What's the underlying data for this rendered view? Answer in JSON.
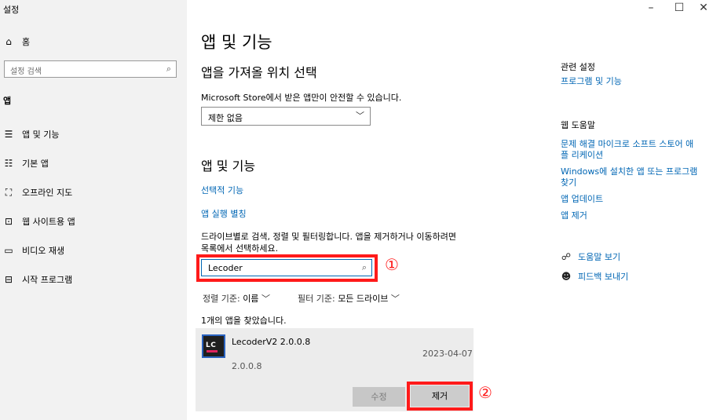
{
  "window": {
    "title": "설정",
    "controls": {
      "minimize": "–",
      "maximize": "☐",
      "close": "✕"
    }
  },
  "sidebar": {
    "home_label": "홈",
    "search_placeholder": "설정 검색",
    "section_title": "앱",
    "items": [
      {
        "label": "앱 및 기능",
        "icon": "list-icon",
        "glyph": "☰"
      },
      {
        "label": "기본 앱",
        "icon": "default-apps-icon",
        "glyph": "☷"
      },
      {
        "label": "오프라인 지도",
        "icon": "map-icon",
        "glyph": "⛶"
      },
      {
        "label": "웹 사이트용 앱",
        "icon": "website-app-icon",
        "glyph": "⊡"
      },
      {
        "label": "비디오 재생",
        "icon": "video-icon",
        "glyph": "▭"
      },
      {
        "label": "시작 프로그램",
        "icon": "startup-icon",
        "glyph": "⊟"
      }
    ]
  },
  "main": {
    "title": "앱 및 기능",
    "source_section": {
      "heading": "앱을 가져올 위치 선택",
      "description": "Microsoft Store에서 받은 앱만이 안전할 수 있습니다.",
      "dropdown_value": "제한 없음"
    },
    "apps_section": {
      "heading": "앱 및 기능",
      "optional_features_link": "선택적 기능",
      "app_aliases_link": "앱 실행 별칭",
      "instructions_line1": "드라이브별로 검색, 정렬 및 필터링합니다. 앱을 제거하거나 이동하려면",
      "instructions_line2": "목록에서 선택하세요.",
      "search_value": "Lecoder",
      "annotation_1": "①",
      "sort_label": "정렬 기준:",
      "sort_value": "이름",
      "filter_label": "필터 기준:",
      "filter_value": "모든 드라이브",
      "result_count": "1개의 앱을 찾았습니다.",
      "app": {
        "name": "LecoderV2 2.0.0.8",
        "date": "2023-04-07",
        "version": "2.0.0.8",
        "icon_text": "LC",
        "modify_label": "수정",
        "uninstall_label": "제거",
        "annotation_2": "②"
      }
    }
  },
  "right_panel": {
    "related_heading": "관련 설정",
    "related_links": [
      "프로그램 및 기능"
    ],
    "help_heading": "웹 도움말",
    "help_links": [
      {
        "line1": "문제 해결 마이크로 소프트 스토어 애",
        "line2": "플 리케이션"
      },
      {
        "line1": "Windows에 설치한 앱 또는 프로그램",
        "line2": "찾기"
      },
      {
        "line1": "앱 업데이트",
        "line2": ""
      },
      {
        "line1": "앱 제거",
        "line2": ""
      }
    ],
    "get_help": "도움말 보기",
    "feedback": "피드백 보내기"
  },
  "colors": {
    "accent": "#0066b4",
    "highlight": "#ff1a1a",
    "sidebar_bg": "#f2f2f2"
  }
}
